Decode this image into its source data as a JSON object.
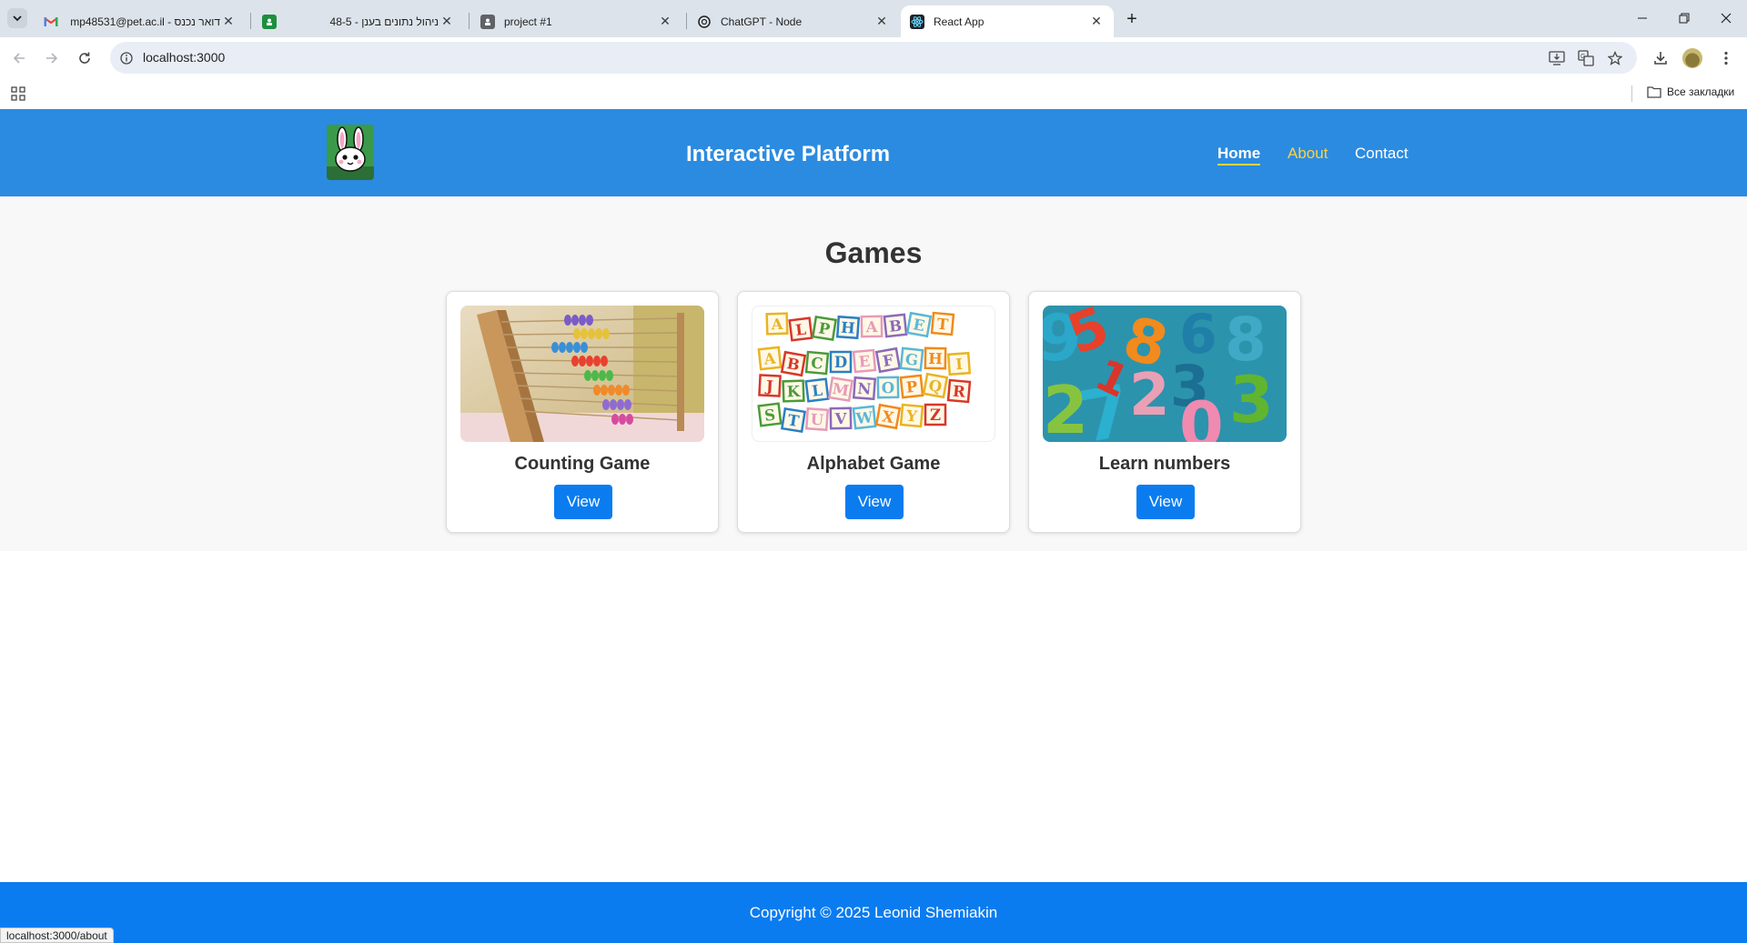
{
  "browser": {
    "tabs": [
      {
        "title": "דואר נכנס - mp48531@pet.ac.il",
        "favicon": "gmail-icon",
        "active": false
      },
      {
        "title": "ניהול נתונים בענן - 48-5",
        "favicon": "classroom-icon",
        "active": false
      },
      {
        "title": "project #1",
        "favicon": "portrait-icon",
        "active": false
      },
      {
        "title": "ChatGPT - Node",
        "favicon": "chatgpt-icon",
        "active": false
      },
      {
        "title": "React App",
        "favicon": "react-icon",
        "active": true
      }
    ],
    "close_glyph": "✕",
    "new_tab_glyph": "+",
    "address": "localhost:3000",
    "bookmarks_all_label": "Все закладки",
    "status_url": "localhost:3000/about",
    "colors": {
      "tabstrip": "#dde3ea",
      "omnibox": "#e9eef6"
    }
  },
  "site": {
    "title": "Interactive Platform",
    "logo": "bunny-logo",
    "nav": {
      "home": "Home",
      "about": "About",
      "contact": "Contact"
    },
    "colors": {
      "header": "#2b8be0",
      "nav_accent": "#ffd23f",
      "button": "#0a7cf0",
      "footer": "#0a7cf0"
    }
  },
  "games": {
    "heading": "Games",
    "cards": [
      {
        "title": "Counting Game",
        "button": "View",
        "image": "abacus-image"
      },
      {
        "title": "Alphabet Game",
        "button": "View",
        "image": "alphabet-blocks-image"
      },
      {
        "title": "Learn numbers",
        "button": "View",
        "image": "colorful-numbers-image"
      }
    ]
  },
  "footer": {
    "text": "Copyright © 2025 Leonid Shemiakin"
  }
}
